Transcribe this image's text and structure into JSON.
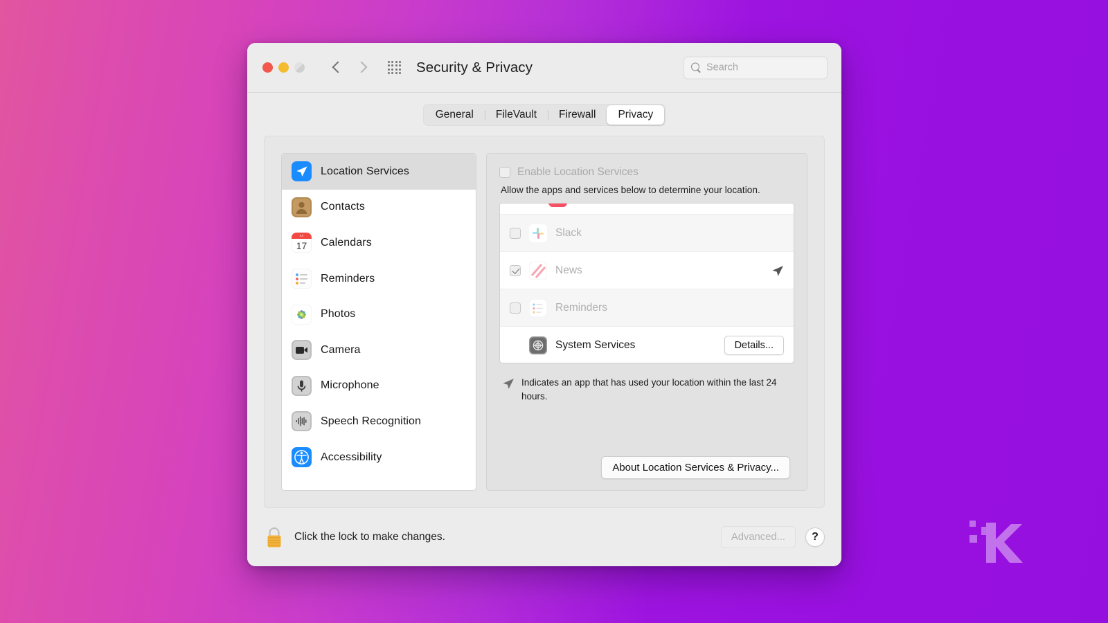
{
  "window": {
    "title": "Security & Privacy",
    "traffic_lights": [
      "close",
      "minimize",
      "maximize"
    ],
    "nav": {
      "back": "back",
      "forward": "forward"
    },
    "grid_button": "show-all",
    "search": {
      "placeholder": "Search",
      "value": ""
    }
  },
  "tabs": [
    {
      "label": "General",
      "active": false
    },
    {
      "label": "FileVault",
      "active": false
    },
    {
      "label": "Firewall",
      "active": false
    },
    {
      "label": "Privacy",
      "active": true
    }
  ],
  "sidebar": {
    "items": [
      {
        "label": "Location Services",
        "icon": "location-arrow-icon",
        "selected": true
      },
      {
        "label": "Contacts",
        "icon": "contacts-icon",
        "selected": false
      },
      {
        "label": "Calendars",
        "icon": "calendar-icon",
        "selected": false
      },
      {
        "label": "Reminders",
        "icon": "reminders-icon",
        "selected": false
      },
      {
        "label": "Photos",
        "icon": "photos-icon",
        "selected": false
      },
      {
        "label": "Camera",
        "icon": "camera-icon",
        "selected": false
      },
      {
        "label": "Microphone",
        "icon": "microphone-icon",
        "selected": false
      },
      {
        "label": "Speech Recognition",
        "icon": "speech-recognition-icon",
        "selected": false
      },
      {
        "label": "Accessibility",
        "icon": "accessibility-icon",
        "selected": false
      }
    ]
  },
  "detail": {
    "enable_checkbox": {
      "label": "Enable Location Services",
      "checked": false,
      "disabled": true
    },
    "description": "Allow the apps and services below to determine your location.",
    "app_rows": [
      {
        "name": "Slack",
        "checked": false,
        "recent_location": false,
        "icon": "slack-icon",
        "disabled": true
      },
      {
        "name": "News",
        "checked": true,
        "recent_location": true,
        "icon": "news-icon",
        "disabled": true
      },
      {
        "name": "Reminders",
        "checked": false,
        "recent_location": false,
        "icon": "reminders-icon",
        "disabled": true
      },
      {
        "name": "System Services",
        "checked": null,
        "recent_location": false,
        "icon": "system-services-icon",
        "disabled": false,
        "button": "Details..."
      }
    ],
    "legend": "Indicates an app that has used your location within the last 24 hours.",
    "about_button": "About Location Services & Privacy..."
  },
  "footer": {
    "lock_icon": "lock-closed-icon",
    "lock_text": "Click the lock to make changes.",
    "advanced_button": "Advanced...",
    "help_button": "?"
  },
  "watermark": {
    "letter": "K"
  },
  "colors": {
    "background_start": "#e2559f",
    "background_end": "#9510df",
    "accent_blue": "#1b8cff",
    "window_bg": "#ececec"
  }
}
